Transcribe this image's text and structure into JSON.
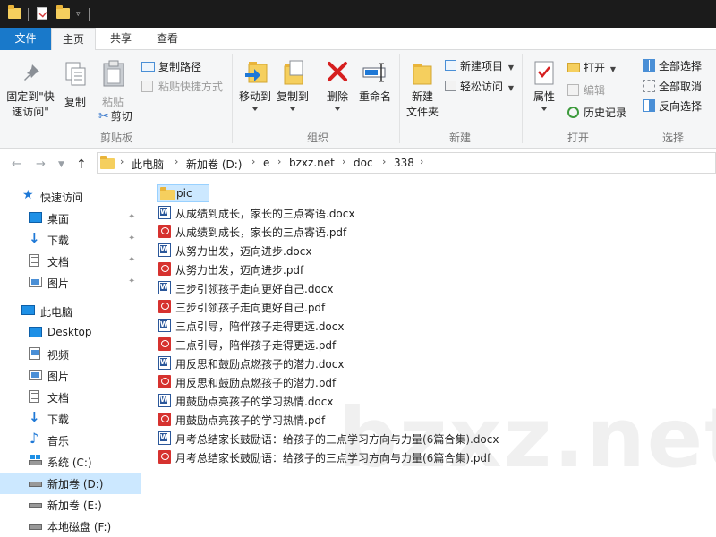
{
  "ribbon_tabs": {
    "file": "文件",
    "home": "主页",
    "share": "共享",
    "view": "查看"
  },
  "clipboard": {
    "pin_line1": "固定到\"快",
    "pin_line2": "速访问\"",
    "copy": "复制",
    "paste": "粘贴",
    "copy_path": "复制路径",
    "paste_shortcut": "粘贴快捷方式",
    "cut": "剪切",
    "group": "剪贴板"
  },
  "organize": {
    "move_to": "移动到",
    "copy_to": "复制到",
    "delete": "删除",
    "rename": "重命名",
    "group": "组织"
  },
  "new_group": {
    "new_folder_line1": "新建",
    "new_folder_line2": "文件夹",
    "new_item": "新建项目",
    "easy_access": "轻松访问",
    "group": "新建"
  },
  "open_group": {
    "properties": "属性",
    "open": "打开",
    "edit": "编辑",
    "history": "历史记录",
    "group": "打开"
  },
  "select_group": {
    "select_all": "全部选择",
    "select_none": "全部取消",
    "invert": "反向选择",
    "group": "选择"
  },
  "breadcrumb": [
    "此电脑",
    "新加卷 (D:)",
    "e",
    "bzxz.net",
    "doc",
    "338"
  ],
  "sidebar": {
    "quick_access": "快速访问",
    "qa_items": [
      "桌面",
      "下载",
      "文档",
      "图片"
    ],
    "this_pc": "此电脑",
    "pc_items": [
      "Desktop",
      "视频",
      "图片",
      "文档",
      "下载",
      "音乐",
      "系统 (C:)",
      "新加卷 (D:)",
      "新加卷 (E:)",
      "本地磁盘 (F:)"
    ]
  },
  "files": [
    {
      "name": "pic",
      "type": "folder"
    },
    {
      "name": "从成绩到成长，家长的三点寄语.docx",
      "type": "docx"
    },
    {
      "name": "从成绩到成长，家长的三点寄语.pdf",
      "type": "pdf"
    },
    {
      "name": "从努力出发，迈向进步.docx",
      "type": "docx"
    },
    {
      "name": "从努力出发，迈向进步.pdf",
      "type": "pdf"
    },
    {
      "name": "三步引领孩子走向更好自己.docx",
      "type": "docx"
    },
    {
      "name": "三步引领孩子走向更好自己.pdf",
      "type": "pdf"
    },
    {
      "name": "三点引导，陪伴孩子走得更远.docx",
      "type": "docx"
    },
    {
      "name": "三点引导，陪伴孩子走得更远.pdf",
      "type": "pdf"
    },
    {
      "name": "用反思和鼓励点燃孩子的潜力.docx",
      "type": "docx"
    },
    {
      "name": "用反思和鼓励点燃孩子的潜力.pdf",
      "type": "pdf"
    },
    {
      "name": "用鼓励点亮孩子的学习热情.docx",
      "type": "docx"
    },
    {
      "name": "用鼓励点亮孩子的学习热情.pdf",
      "type": "pdf"
    },
    {
      "name": "月考总结家长鼓励语：给孩子的三点学习方向与力量(6篇合集).docx",
      "type": "docx"
    },
    {
      "name": "月考总结家长鼓励语：给孩子的三点学习方向与力量(6篇合集).pdf",
      "type": "pdf"
    }
  ],
  "watermark": "bzxz.net"
}
